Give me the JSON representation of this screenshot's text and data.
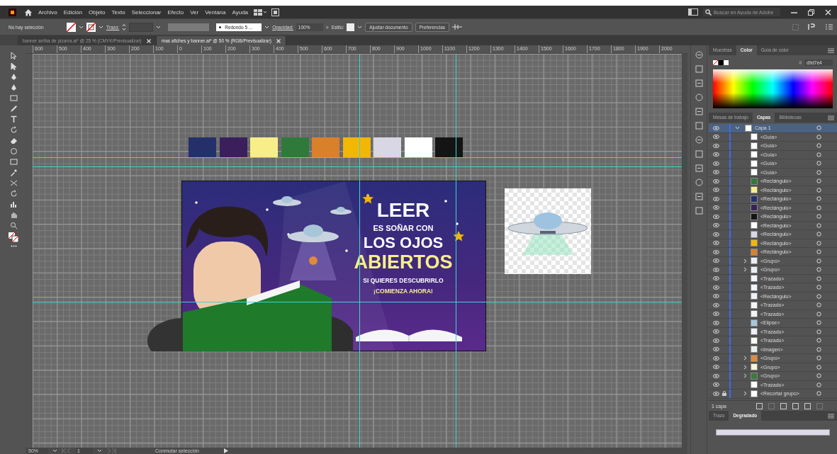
{
  "menu": [
    "Archivo",
    "Edición",
    "Objeto",
    "Texto",
    "Seleccionar",
    "Efecto",
    "Ver",
    "Ventana",
    "Ayuda"
  ],
  "search": {
    "placeholder": "Buscar en Ayuda de Adobe"
  },
  "control_bar": {
    "selection": "No hay selección",
    "stroke_label": "Trazo:",
    "brush": "Redondo 5 ...",
    "opacity_label": "Opacidad:",
    "opacity": "100%",
    "arrow": ">",
    "style_label": "Estilo:",
    "buttons": [
      "Ajustar documento",
      "Preferencias"
    ]
  },
  "tabs": [
    {
      "label": "banner arriba de pizarra.ai* @ 25 % (CMYK/Previsualizar)",
      "selected": false
    },
    {
      "label": "mas afiches y banner.ai* @ 50 % (RGB/Previsualizar)",
      "selected": true
    }
  ],
  "ruler": [
    "600",
    "500",
    "400",
    "300",
    "200",
    "100",
    "0",
    "100",
    "200",
    "300",
    "400",
    "500",
    "600",
    "700",
    "800",
    "900",
    "1000",
    "1100",
    "1200",
    "1300",
    "1400",
    "1500",
    "1600",
    "1700",
    "1800",
    "1900",
    "2000"
  ],
  "swatches": [
    {
      "color": "#25306b"
    },
    {
      "color": "#3a1f5c"
    },
    {
      "color": "#f7ee8a"
    },
    {
      "color": "#2f7a3a"
    },
    {
      "color": "#d9802a"
    },
    {
      "color": "#f2b705"
    },
    {
      "color": "#d9d7e4"
    },
    {
      "color": "#ffffff"
    },
    {
      "color": "#141414"
    }
  ],
  "artboard": {
    "lines": [
      {
        "text": "LEER",
        "kind": "big"
      },
      {
        "text": "ES SOÑAR CON",
        "kind": "small"
      },
      {
        "text": "LOS OJOS",
        "kind": "medium"
      },
      {
        "text": "ABIERTOS",
        "kind": "highlight"
      },
      {
        "text": "SI QUIERES DESCUBRIRLO",
        "kind": "tiny"
      },
      {
        "text": "¡COMIENZA AHORA!",
        "kind": "tinyhighlight"
      }
    ]
  },
  "color_panel": {
    "tabs": [
      {
        "label": "Muestras",
        "selected": false
      },
      {
        "label": "Color",
        "selected": true
      },
      {
        "label": "Guía de color",
        "selected": false
      }
    ],
    "hash": "#",
    "hex": "d9d7e4"
  },
  "layers_panel": {
    "tabs": [
      {
        "label": "Mesas de trabajo",
        "selected": false
      },
      {
        "label": "Capas",
        "selected": true
      },
      {
        "label": "Bibliotecas",
        "selected": false
      }
    ],
    "layer": {
      "name": "Capa 1",
      "expanded": true,
      "selected": true
    },
    "items": [
      {
        "name": "<Guía>",
        "color": "#ffffff",
        "expandable": false,
        "locked": false
      },
      {
        "name": "<Guía>",
        "color": "#ffffff",
        "expandable": false,
        "locked": false
      },
      {
        "name": "<Guía>",
        "color": "#ffffff",
        "expandable": false,
        "locked": false
      },
      {
        "name": "<Guía>",
        "color": "#ffffff",
        "expandable": false,
        "locked": false
      },
      {
        "name": "<Guía>",
        "color": "#ffffff",
        "expandable": false,
        "locked": false
      },
      {
        "name": "<Rectángulo>",
        "color": "#2f7a3a",
        "expandable": false,
        "locked": false
      },
      {
        "name": "<Rectángulo>",
        "color": "#f7ee8a",
        "expandable": false,
        "locked": false
      },
      {
        "name": "<Rectángulo>",
        "color": "#25306b",
        "expandable": false,
        "locked": false
      },
      {
        "name": "<Rectángulo>",
        "color": "#3a1f5c",
        "expandable": false,
        "locked": false
      },
      {
        "name": "<Rectángulo>",
        "color": "#141414",
        "expandable": false,
        "locked": false
      },
      {
        "name": "<Rectángulo>",
        "color": "#ffffff",
        "expandable": false,
        "locked": false
      },
      {
        "name": "<Rectángulo>",
        "color": "#d9d7e4",
        "expandable": false,
        "locked": false
      },
      {
        "name": "<Rectángulo>",
        "color": "#f2b705",
        "expandable": false,
        "locked": false
      },
      {
        "name": "<Rectángulo>",
        "color": "#d9802a",
        "expandable": false,
        "locked": false
      },
      {
        "name": "<Grupo>",
        "color": "#e8eef5",
        "expandable": true,
        "locked": false
      },
      {
        "name": "<Grupo>",
        "color": "#e8eef5",
        "expandable": true,
        "locked": false
      },
      {
        "name": "<Trazado>",
        "color": "#f2f5fa",
        "expandable": false,
        "locked": false
      },
      {
        "name": "<Trazado>",
        "color": "#f2f5fa",
        "expandable": false,
        "locked": false
      },
      {
        "name": "<Rectángulo>",
        "color": "#eef0f6",
        "expandable": false,
        "locked": false
      },
      {
        "name": "<Trazado>",
        "color": "#f5f5f8",
        "expandable": false,
        "locked": false
      },
      {
        "name": "<Trazado>",
        "color": "#f5f5f8",
        "expandable": false,
        "locked": false
      },
      {
        "name": "<Elipse>",
        "color": "#a9c6d9",
        "expandable": false,
        "locked": false
      },
      {
        "name": "<Trazado>",
        "color": "#f0eef8",
        "expandable": false,
        "locked": false
      },
      {
        "name": "<Trazado>",
        "color": "#fbfbf5",
        "expandable": false,
        "locked": false
      },
      {
        "name": "<Imagen>",
        "color": "#e6efe9",
        "expandable": false,
        "locked": false
      },
      {
        "name": "<Grupo>",
        "color": "#e08a3a",
        "expandable": true,
        "locked": false
      },
      {
        "name": "<Grupo>",
        "color": "#f8f4d8",
        "expandable": true,
        "locked": false
      },
      {
        "name": "<Grupo>",
        "color": "#3c7a3c",
        "expandable": true,
        "locked": false
      },
      {
        "name": "<Trazado>",
        "color": "#ffffff",
        "expandable": false,
        "locked": false
      },
      {
        "name": "<Recortar grupo>",
        "color": "#ffffff",
        "expandable": true,
        "locked": true
      }
    ],
    "footer": "1 capa"
  },
  "gradient_panel": {
    "tabs": [
      {
        "label": "Trazo",
        "selected": false
      },
      {
        "label": "Degradado",
        "selected": true
      }
    ]
  },
  "status_bar": {
    "zoom": "50%",
    "artboard": "1",
    "action": "Conmutar selección"
  }
}
